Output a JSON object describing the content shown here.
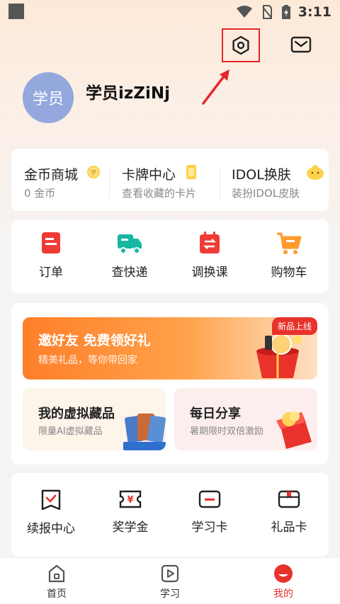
{
  "status_bar": {
    "time": "3:11"
  },
  "header": {
    "settings_icon": "hexagon-settings-icon",
    "message_icon": "mail-icon"
  },
  "profile": {
    "avatar_text": "学员",
    "username": "学员izZiNj"
  },
  "quick_links": [
    {
      "title": "金币商城",
      "subtitle": "0 金币",
      "icon": "coin-icon"
    },
    {
      "title": "卡牌中心",
      "subtitle": "查看收藏的卡片",
      "icon": "card-icon"
    },
    {
      "title": "IDOL换肤",
      "subtitle": "装扮IDOL皮肤",
      "icon": "chick-icon"
    }
  ],
  "order_grid": [
    {
      "label": "订单",
      "icon": "order-icon"
    },
    {
      "label": "查快递",
      "icon": "truck-icon"
    },
    {
      "label": "调换课",
      "icon": "swap-icon"
    },
    {
      "label": "购物车",
      "icon": "cart-icon"
    }
  ],
  "promo": {
    "banner_title": "邀好友 免费领好礼",
    "banner_subtitle": "精美礼品，等你带回家",
    "badge": "新品上线",
    "card_left_title": "我的虚拟藏品",
    "card_left_subtitle": "限量AI虚拟藏品",
    "card_right_title": "每日分享",
    "card_right_subtitle": "暑期限时双倍激励"
  },
  "services": [
    {
      "label": "续报中心",
      "icon": "renew-icon"
    },
    {
      "label": "奖学金",
      "icon": "ticket-yen-icon"
    },
    {
      "label": "学习卡",
      "icon": "study-card-icon"
    },
    {
      "label": "礼品卡",
      "icon": "gift-card-icon"
    }
  ],
  "tabs": [
    {
      "label": "首页",
      "icon": "home-icon"
    },
    {
      "label": "学习",
      "icon": "play-icon"
    },
    {
      "label": "我的",
      "icon": "profile-icon",
      "active": true
    }
  ],
  "colors": {
    "accent": "#e8322b",
    "avatar": "#93a8dd",
    "banner": "#ff8c35"
  }
}
